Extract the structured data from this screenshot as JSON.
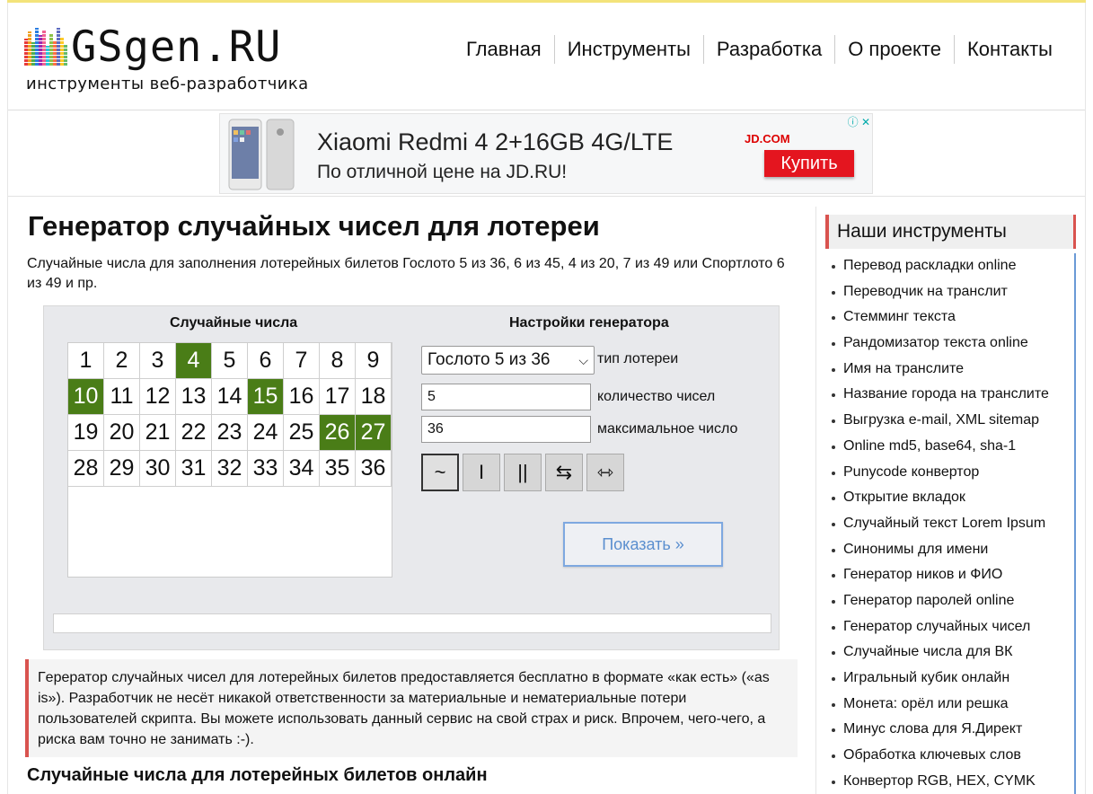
{
  "header": {
    "logo_text": "GSgen.RU",
    "logo_subtitle": "инструменты веб-разработчика",
    "nav": [
      "Главная",
      "Инструменты",
      "Разработка",
      "О проекте",
      "Контакты"
    ]
  },
  "ad": {
    "title": "Xiaomi Redmi 4 2+16GB 4G/LTE",
    "description": "По отличной цене на JD.RU!",
    "brand": "JD.COM",
    "button": "Купить",
    "info_icon": "ⓘ",
    "close_icon": "✕"
  },
  "main": {
    "title": "Генератор случайных чисел для лотереи",
    "intro": "Случайные числа для заполнения лотерейных билетов Гослото 5 из 36, 6 из 45, 4 из 20, 7 из 49 или Спортлото 6 из 49 и пр.",
    "numbers_heading": "Случайные числа",
    "settings_heading": "Настройки генератора",
    "numbers": [
      1,
      2,
      3,
      4,
      5,
      6,
      7,
      8,
      9,
      10,
      11,
      12,
      13,
      14,
      15,
      16,
      17,
      18,
      19,
      20,
      21,
      22,
      23,
      24,
      25,
      26,
      27,
      28,
      29,
      30,
      31,
      32,
      33,
      34,
      35,
      36
    ],
    "selected": [
      4,
      10,
      15,
      26,
      27
    ],
    "lottery_type_value": "Гослото 5 из 36",
    "lottery_type_label": "тип лотереи",
    "count_value": "5",
    "count_label": "количество чисел",
    "max_value": "36",
    "max_label": "максимальное число",
    "mode_buttons": [
      "~",
      "I",
      "||",
      "⇆",
      "⇿"
    ],
    "show_button": "Показать »",
    "notice": "Гeрератор случайных чисел для лотерейных билетов предоставляется бесплатно в формате «как есть» («as is»). Разработчик не несёт никакой ответственности за материальные и нематериальные потери пользователей скрипта. Вы можете использовать данный сервис на свой страх и риск. Впрочем, чего-чего, а риска вам точно не занимать :-).",
    "subtitle": "Случайные числа для лотерейных билетов онлайн"
  },
  "sidebar": {
    "title": "Наши инструменты",
    "items": [
      "Перевод раскладки online",
      "Переводчик на транслит",
      "Стемминг текста",
      "Рандомизатор текста online",
      "Имя на транслите",
      "Название города на транслите",
      "Выгрузка e-mail, XML sitemap",
      "Online md5, base64, sha-1",
      "Punycode конвертор",
      "Открытие вкладок",
      "Случайный текст Lorem Ipsum",
      "Синонимы для имени",
      "Генератор ников и ФИО",
      "Генератор паролей online",
      "Генератор случайных чисел",
      "Случайные числа для ВК",
      "Игральный кубик онлайн",
      "Монета: орёл или решка",
      "Минус слова для Я.Директ",
      "Обработка ключевых слов",
      "Конвертор RGB, HEX, CYMK"
    ]
  },
  "colors": {
    "selected_cell": "#4a7d17",
    "accent_red": "#d9534f",
    "link_blue": "#5b8fcf"
  }
}
